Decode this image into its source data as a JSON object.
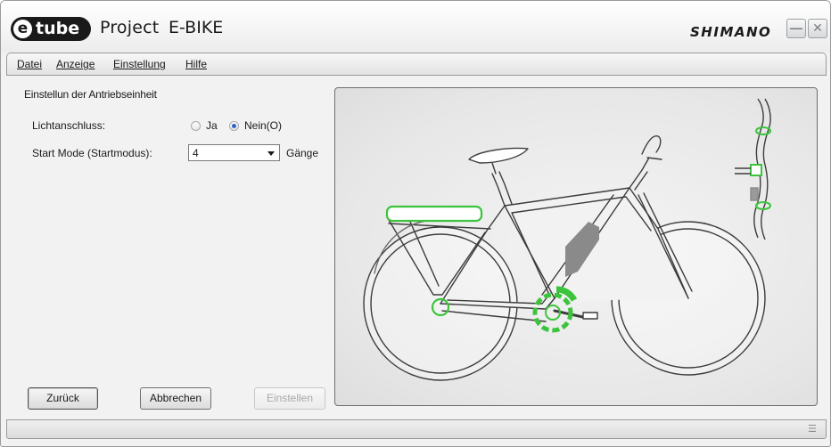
{
  "titlebar": {
    "logo_e": "e",
    "logo_text": "tube",
    "app_name": "Project",
    "mode": "E-BIKE",
    "brand": "SHIMANO"
  },
  "menu": {
    "items": [
      "Datei",
      "Anzeige",
      "Einstellung",
      "Hilfe"
    ]
  },
  "settings": {
    "section_title": "Einstellun der Antriebseinheit",
    "light_label": "Lichtanschluss:",
    "light_options": [
      "Ja",
      "Nein(O)"
    ],
    "light_selected": "Nein(O)",
    "start_mode_label": "Start Mode (Startmodus):",
    "start_mode_value": "4",
    "start_mode_unit": "Gänge"
  },
  "buttons": {
    "back": "Zurück",
    "cancel": "Abbrechen",
    "apply": "Einstellen"
  },
  "colors": {
    "highlight": "#3cc43c",
    "battery": "#8a8a8a"
  },
  "icons": [
    "minimize-icon",
    "close-icon",
    "statusbar-menu-icon",
    "radio-icon",
    "dropdown-arrow-icon"
  ]
}
